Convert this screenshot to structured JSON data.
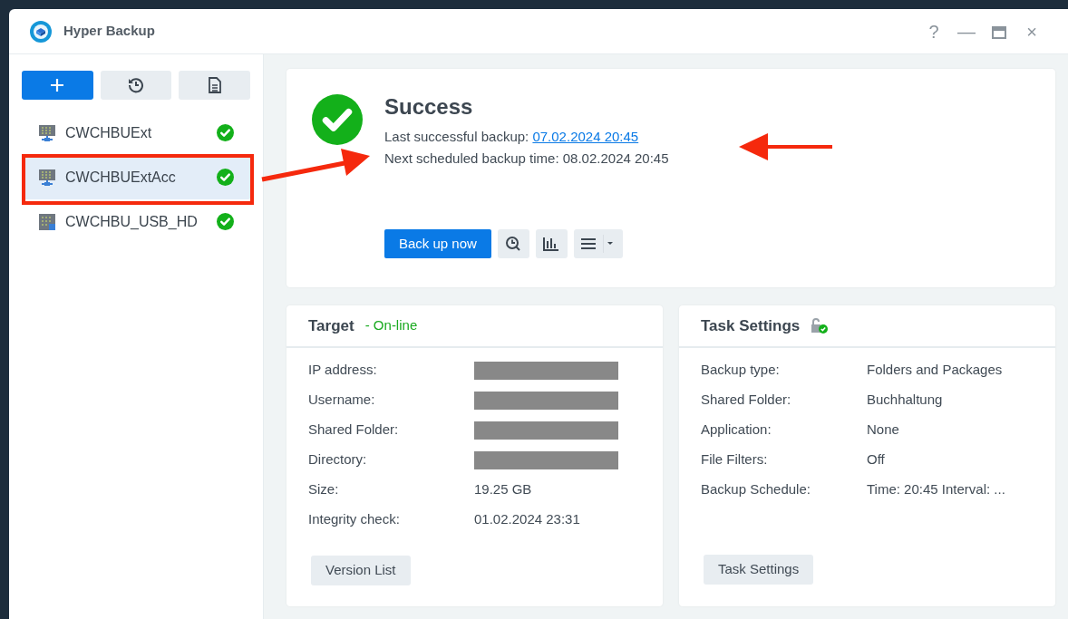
{
  "window": {
    "title": "Hyper Backup",
    "controls": [
      "?",
      "—",
      "×"
    ]
  },
  "toolbar": [
    {
      "kind": "add",
      "primary": true
    },
    {
      "kind": "restore",
      "primary": false
    },
    {
      "kind": "log",
      "primary": false
    }
  ],
  "tasks": [
    {
      "name": "CWCHBUExt",
      "kind": "network",
      "success": true,
      "selected": false
    },
    {
      "name": "CWCHBUExtAcc",
      "kind": "network",
      "success": true,
      "selected": true
    },
    {
      "name": "CWCHBU_USB_HD",
      "kind": "usb",
      "success": true,
      "selected": false
    }
  ],
  "status": {
    "success": true,
    "title": "Success",
    "last_label": "Last successful backup:",
    "last_value": "07.02.2024 20:45",
    "next_text": "Next scheduled backup time: 08.02.2024 20:45",
    "primary_button": "Back up now"
  },
  "target": {
    "title": "Target",
    "status": "- On-line",
    "online": true,
    "rows": [
      {
        "label": "IP address:",
        "redacted": true
      },
      {
        "label": "Username:",
        "redacted": true
      },
      {
        "label": "Shared Folder:",
        "redacted": true
      },
      {
        "label": "Directory:",
        "redacted": true
      },
      {
        "label": "Size:",
        "value": "19.25 GB",
        "redacted": false
      },
      {
        "label": "Integrity check:",
        "value": "01.02.2024 23:31",
        "redacted": false
      }
    ],
    "button": "Version List"
  },
  "task_settings": {
    "title": "Task Settings",
    "encrypted": true,
    "rows": [
      {
        "label": "Backup type:",
        "value": "Folders and Packages"
      },
      {
        "label": "Shared Folder:",
        "value": "Buchhaltung"
      },
      {
        "label": "Application:",
        "value": "None"
      },
      {
        "label": "File Filters:",
        "value": "Off"
      },
      {
        "label": "Backup Schedule:",
        "value": "Time: 20:45 Interval: ..."
      }
    ],
    "button": "Task Settings"
  }
}
